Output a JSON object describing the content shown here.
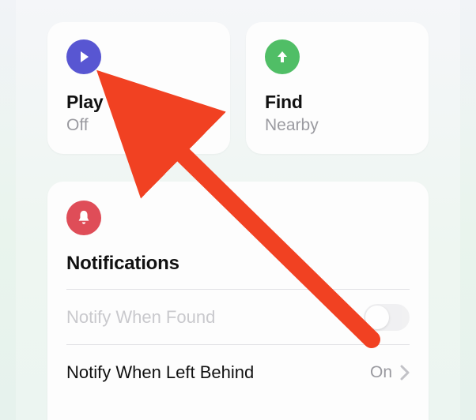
{
  "cards": {
    "play_sound": {
      "title": "Play Sound",
      "subtitle": "Off",
      "icon_bg": "#5856d2"
    },
    "find": {
      "title": "Find",
      "subtitle": "Nearby",
      "icon_bg": "#50be66"
    }
  },
  "notifications": {
    "heading": "Notifications",
    "icon_bg": "#df4d58",
    "rows": {
      "when_found": {
        "label": "Notify When Found",
        "toggle_on": false,
        "enabled": false
      },
      "left_behind": {
        "label": "Notify When Left Behind",
        "value": "On"
      }
    }
  },
  "annotation": {
    "arrow_color": "#f14122"
  }
}
